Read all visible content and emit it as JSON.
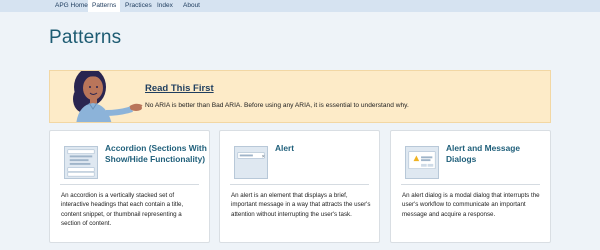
{
  "nav": {
    "items": [
      {
        "label": "APG Home",
        "active": false
      },
      {
        "label": "Patterns",
        "active": true
      },
      {
        "label": "Practices",
        "active": false
      },
      {
        "label": "Index",
        "active": false
      },
      {
        "label": "About",
        "active": false
      }
    ]
  },
  "page": {
    "title": "Patterns"
  },
  "banner": {
    "heading": "Read This First",
    "text": "No ARIA is better than Bad ARIA. Before using any ARIA, it is essential to understand why."
  },
  "cards": [
    {
      "title": "Accordion (Sections With Show/Hide Functionality)",
      "description": "An accordion is a vertically stacked set of interactive headings that each contain a title, content snippet, or thumbnail representing a section of content.",
      "icon": "accordion-icon"
    },
    {
      "title": "Alert",
      "description": "An alert is an element that displays a brief, important message in a way that attracts the user's attention without interrupting the user's task.",
      "icon": "alert-icon"
    },
    {
      "title": "Alert and Message Dialogs",
      "description": "An alert dialog is a modal dialog that interrupts the user's workflow to communicate an important message and acquire a response.",
      "icon": "alertdialog-icon"
    }
  ],
  "colors": {
    "accent": "#1d5b72",
    "banner_bg": "#fdebc8",
    "nav_bg": "#d6e3f1"
  }
}
